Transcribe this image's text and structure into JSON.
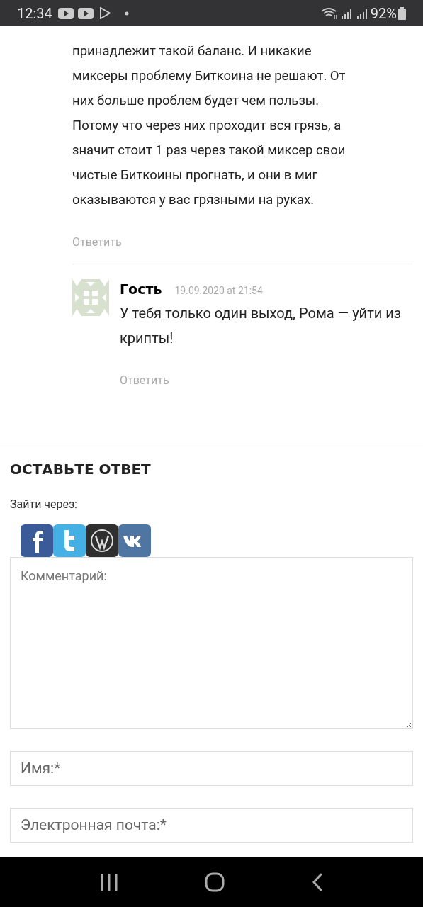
{
  "status_bar": {
    "time": "12:34",
    "battery": "92%"
  },
  "comment": {
    "text": "принадлежит такой баланс. И никакие\nмиксеры проблему Биткоина не решают. От\nних больше проблем будет чем пользы.\nПотому что через них проходит вся грязь, а\nзначит стоит 1 раз через такой миксер свои\nчистые Биткоины прогнать, и они в миг\nоказываются у вас грязными на руках.",
    "reply_link": "Ответить"
  },
  "reply": {
    "author": "Гость",
    "date": "19.09.2020 at 21:54",
    "text": "У тебя только один выход, Рома — уйти из крипты!",
    "reply_link": "Ответить"
  },
  "respond": {
    "title": "ОСТАВЬТЕ ОТВЕТ",
    "login_label": "Зайти через:",
    "social": [
      {
        "kind": "facebook"
      },
      {
        "kind": "twitter"
      },
      {
        "kind": "wordpress"
      },
      {
        "kind": "vk"
      }
    ],
    "comment_placeholder": "Комментарий:",
    "name_placeholder": "Имя:*",
    "email_placeholder": "Электронная почта:*"
  }
}
